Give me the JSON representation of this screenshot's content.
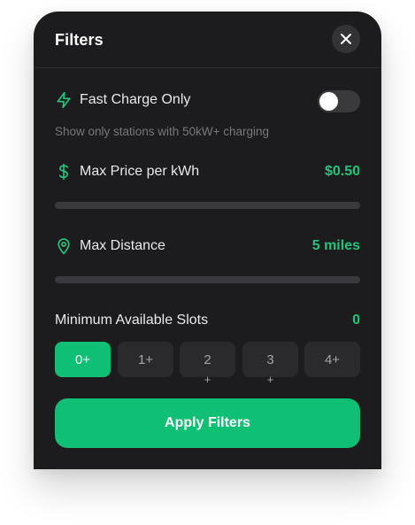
{
  "header": {
    "title": "Filters",
    "close_icon": "close-icon"
  },
  "fast_charge": {
    "label": "Fast Charge Only",
    "icon": "lightning-bolt-icon",
    "enabled": false,
    "description": "Show only stations with 50kW+ charging"
  },
  "max_price": {
    "label": "Max Price per kWh",
    "icon": "dollar-sign-icon",
    "value": "$0.50"
  },
  "max_distance": {
    "label": "Max Distance",
    "icon": "map-pin-icon",
    "value": "5 miles"
  },
  "slots": {
    "label": "Minimum Available Slots",
    "current": "0",
    "options": [
      "0+",
      "1+",
      "2",
      "3",
      "4+"
    ],
    "selected": "0+"
  },
  "apply_label": "Apply Filters",
  "colors": {
    "accent": "#22c57b",
    "button": "#0fbf73",
    "panel_bg": "#1c1c1e"
  }
}
